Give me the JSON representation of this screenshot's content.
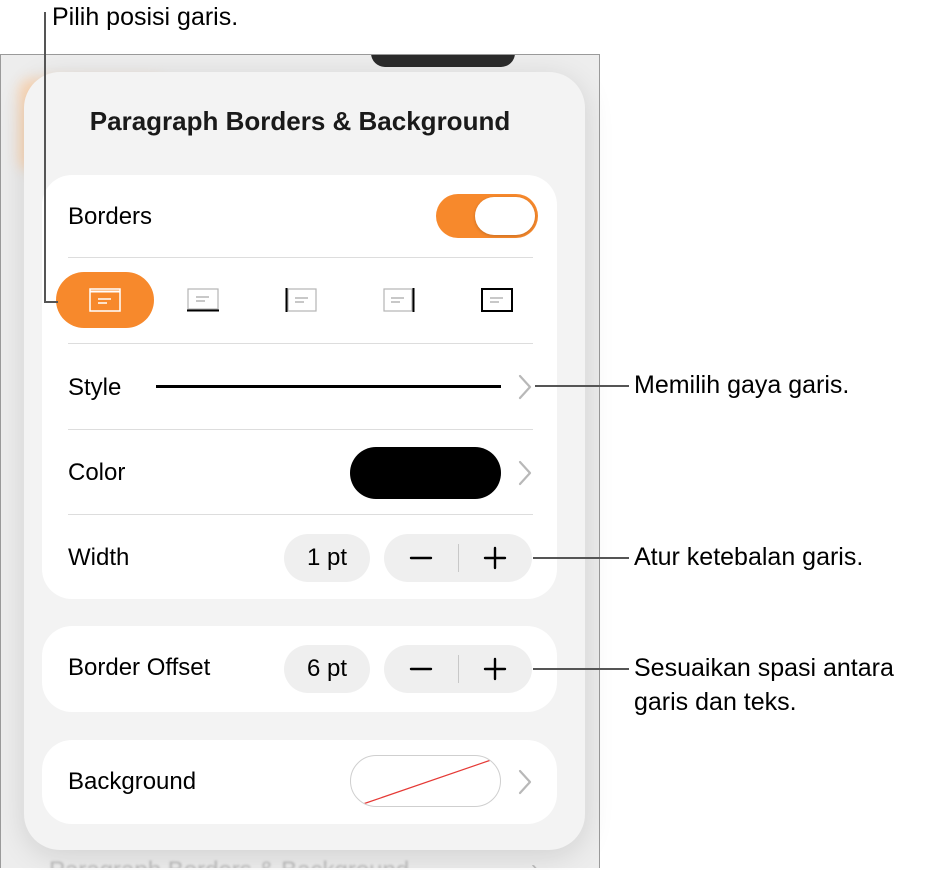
{
  "background_app": {
    "blurred_text": "Paragraph Borders & Background"
  },
  "panel": {
    "title": "Paragraph Borders & Background"
  },
  "borders": {
    "label": "Borders",
    "enabled": true,
    "positions": [
      {
        "name": "around",
        "icon": "border-around-icon",
        "active": true
      },
      {
        "name": "bottom",
        "icon": "border-bottom-icon",
        "active": false
      },
      {
        "name": "left",
        "icon": "border-left-icon",
        "active": false
      },
      {
        "name": "right",
        "icon": "border-right-icon",
        "active": false
      },
      {
        "name": "box",
        "icon": "border-box-icon",
        "active": false
      }
    ]
  },
  "style": {
    "label": "Style"
  },
  "color": {
    "label": "Color",
    "value": "#000000"
  },
  "width": {
    "label": "Width",
    "value": "1 pt"
  },
  "border_offset": {
    "label": "Border Offset",
    "value": "6 pt"
  },
  "background": {
    "label": "Background"
  },
  "colors": {
    "accent": "#f7892c",
    "no_fill_slash": "#e53935"
  },
  "callouts": {
    "position": "Pilih posisi garis.",
    "style": "Memilih gaya garis.",
    "width": "Atur ketebalan garis.",
    "offset_line1": "Sesuaikan spasi antara",
    "offset_line2": "garis dan teks."
  }
}
